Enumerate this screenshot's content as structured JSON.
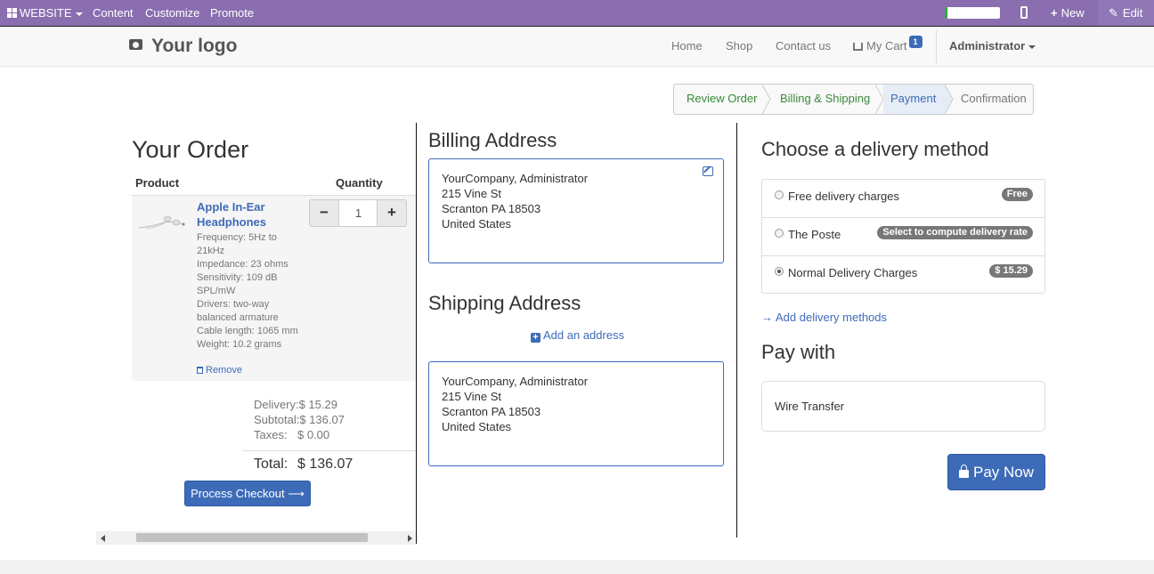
{
  "adminbar": {
    "website_label": "WEBSITE",
    "menu": [
      "Content",
      "Customize",
      "Promote"
    ],
    "progress_fraction": 0.05,
    "new_label": "New",
    "edit_label": "Edit"
  },
  "navbar": {
    "logo_text": "Your logo",
    "links": [
      "Home",
      "Shop",
      "Contact us"
    ],
    "cart_label": "My Cart",
    "cart_count": "1",
    "user_label": "Administrator"
  },
  "wizard": {
    "steps": [
      "Review Order",
      "Billing & Shipping",
      "Payment",
      "Confirmation"
    ]
  },
  "order": {
    "title": "Your Order",
    "col_product": "Product",
    "col_quantity": "Quantity",
    "product_name": "Apple In-Ear Headphones",
    "specs": [
      "Frequency: 5Hz to 21kHz",
      "Impedance: 23 ohms",
      "Sensitivity: 109 dB SPL/mW",
      "Drivers: two-way balanced armature",
      "Cable length: 1065 mm",
      "Weight: 10.2 grams"
    ],
    "remove_label": "Remove",
    "quantity": "1",
    "minus": "−",
    "plus": "+",
    "delivery_label": "Delivery:",
    "delivery_value": "$ 15.29",
    "subtotal_label": "Subtotal:",
    "subtotal_value": "$ 136.07",
    "taxes_label": "Taxes:",
    "taxes_value": "$ 0.00",
    "total_label": "Total:",
    "total_value": "$ 136.07",
    "checkout_label": "Process Checkout",
    "checkout_arrow": "⟶"
  },
  "billing": {
    "title": "Billing Address",
    "lines": [
      "YourCompany, Administrator",
      "215 Vine St",
      "Scranton PA 18503",
      "United States"
    ]
  },
  "shipping": {
    "title": "Shipping Address",
    "add_label": "Add an address",
    "lines": [
      "YourCompany, Administrator",
      "215 Vine St",
      "Scranton PA 18503",
      "United States"
    ]
  },
  "delivery": {
    "title": "Choose a delivery method",
    "methods": [
      {
        "label": "Free delivery charges",
        "badge": "Free",
        "checked": false
      },
      {
        "label": "The Poste",
        "badge": "Select to compute delivery rate",
        "checked": false
      },
      {
        "label": "Normal Delivery Charges",
        "badge": "$ 15.29",
        "checked": true
      }
    ],
    "add_label": "Add delivery methods"
  },
  "payment": {
    "title": "Pay with",
    "method": "Wire Transfer",
    "paynow_label": "Pay Now"
  },
  "colors": {
    "adminbar": "#8a6eb0",
    "primary": "#3d6bb8",
    "step_done": "#3a8a3a",
    "badge": "#777777"
  }
}
